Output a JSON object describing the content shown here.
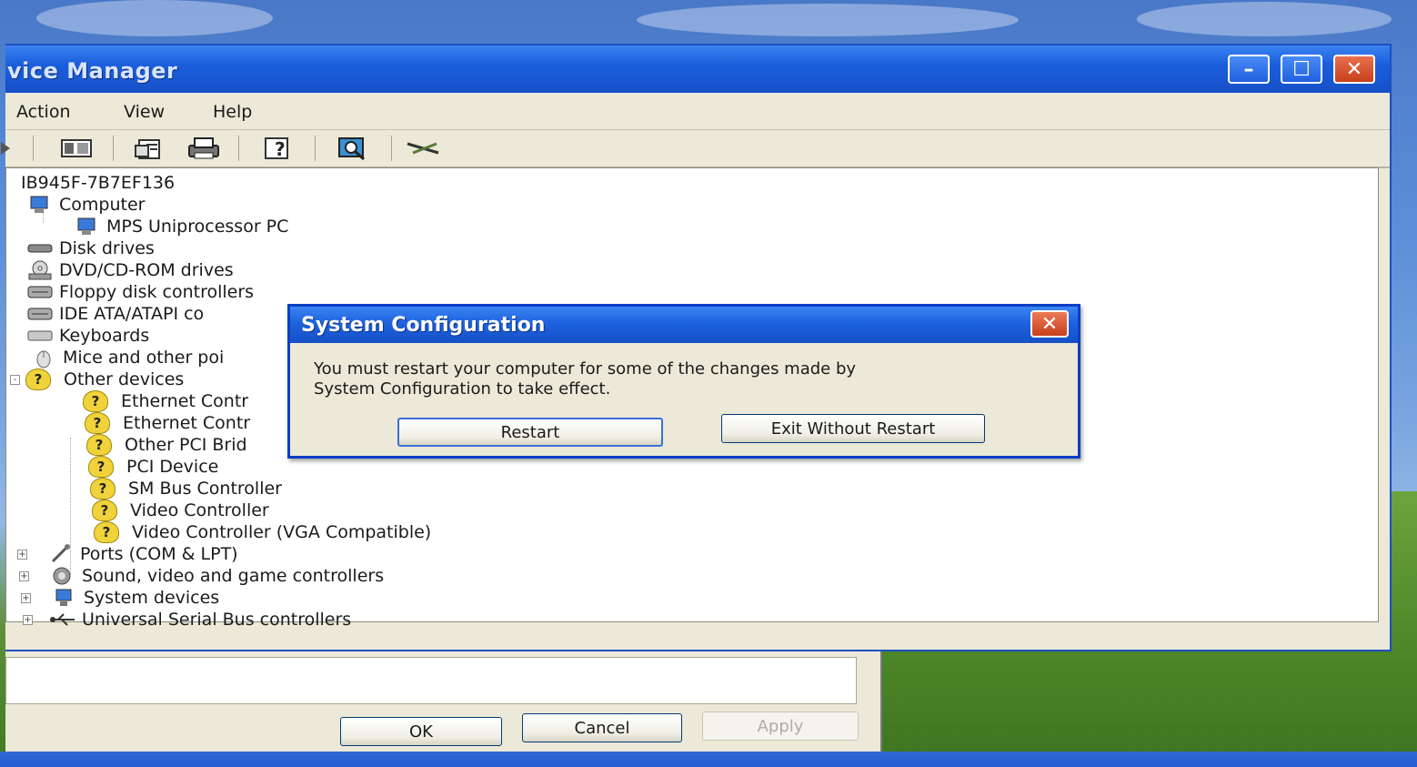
{
  "device_manager": {
    "title": "vice Manager",
    "caption_buttons": {
      "minimize": "–",
      "maximize": "☐",
      "close": "✕"
    },
    "menu": [
      "Action",
      "View",
      "Help"
    ],
    "toolbar_icons": [
      "back-arrow-icon",
      "show-hide-tree-icon",
      "properties-icon",
      "print-icon",
      "help-icon",
      "scan-hardware-icon",
      "update-driver-icon"
    ],
    "tree": {
      "root": "IB945F-7B7EF136",
      "computer": "Computer",
      "computer_child": "MPS Uniprocessor PC",
      "disk_drives": "Disk drives",
      "dvd": "DVD/CD-ROM drives",
      "floppy": "Floppy disk controllers",
      "ide": "IDE ATA/ATAPI co",
      "keyboards": "Keyboards",
      "mice": "Mice and other poi",
      "other_devices": "Other devices",
      "other_children": [
        "Ethernet Contr",
        "Ethernet Contr",
        "Other PCI Brid",
        "PCI Device",
        "SM Bus Controller",
        "Video Controller",
        "Video Controller (VGA Compatible)"
      ],
      "ports": "Ports (COM & LPT)",
      "sound": "Sound, video and game controllers",
      "system_devices": "System devices",
      "usb": "Universal Serial Bus controllers",
      "expander_plus": "+",
      "expander_minus": "-"
    }
  },
  "property_buttons": {
    "ok": "OK",
    "cancel": "Cancel",
    "apply": "Apply"
  },
  "system_configuration": {
    "title": "System Configuration",
    "close": "✕",
    "message_line1": "You must restart your computer for some of the changes made by",
    "message_line2": "System Configuration to take effect.",
    "restart_label": "Restart",
    "exit_label": "Exit Without Restart"
  },
  "icons": {
    "warning_glyph": "?"
  }
}
